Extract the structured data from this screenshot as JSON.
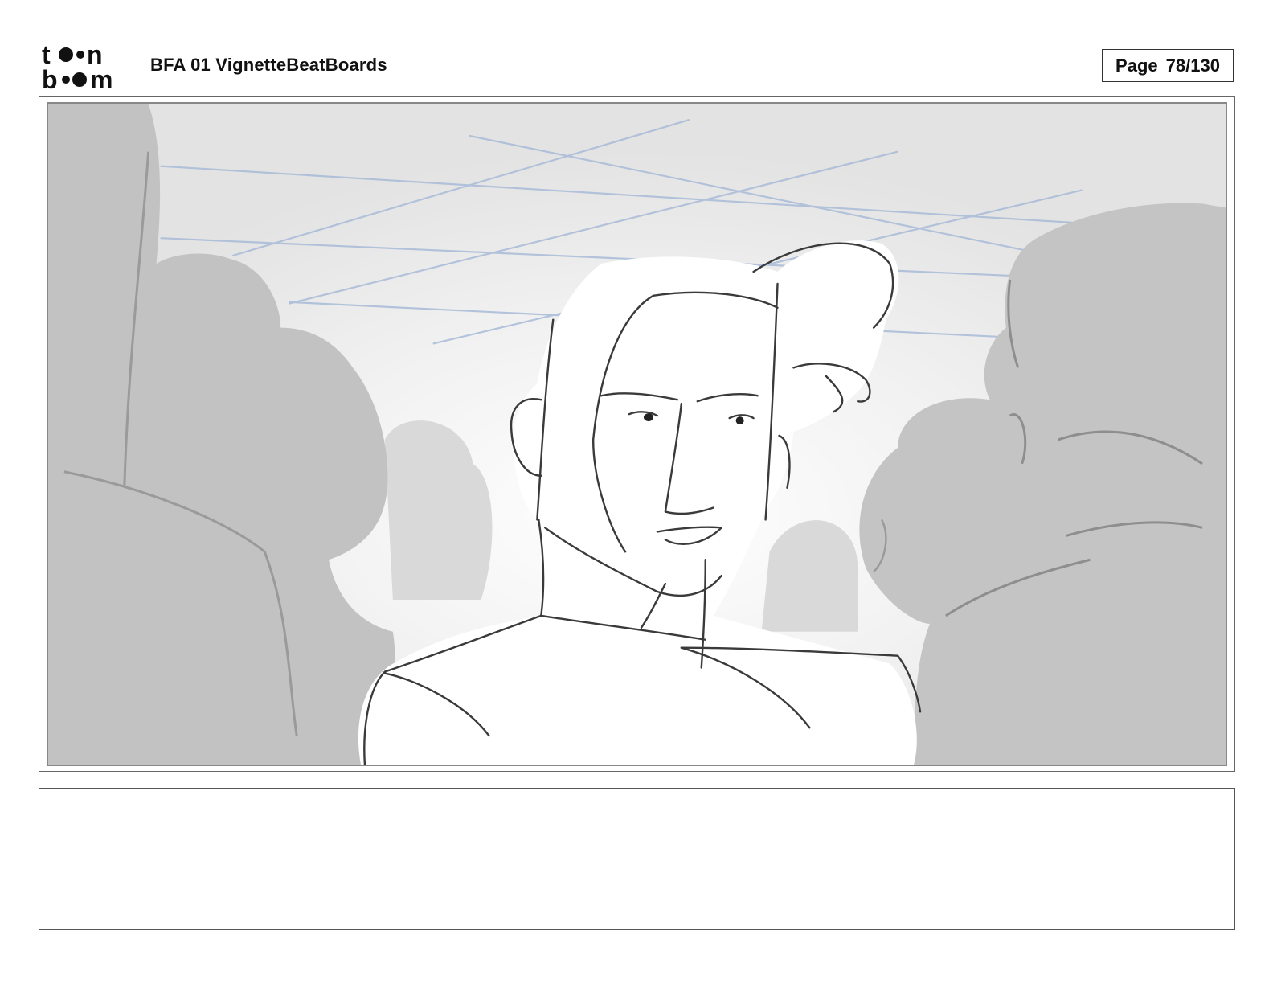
{
  "header": {
    "logo_top": "toon",
    "logo_bottom": "boom",
    "title": "BFA 01 VignetteBeatBoards",
    "page_label": "Page",
    "page_number": "78/130"
  },
  "panel": {
    "colors": {
      "background": "#e4e4e4",
      "crowd": "#c6c6c6",
      "crowd_dark": "#bcbcbc",
      "sketch_line": "#3a3a3a",
      "ceiling_grid": "#a9bbd8"
    }
  },
  "caption": {
    "text": ""
  }
}
